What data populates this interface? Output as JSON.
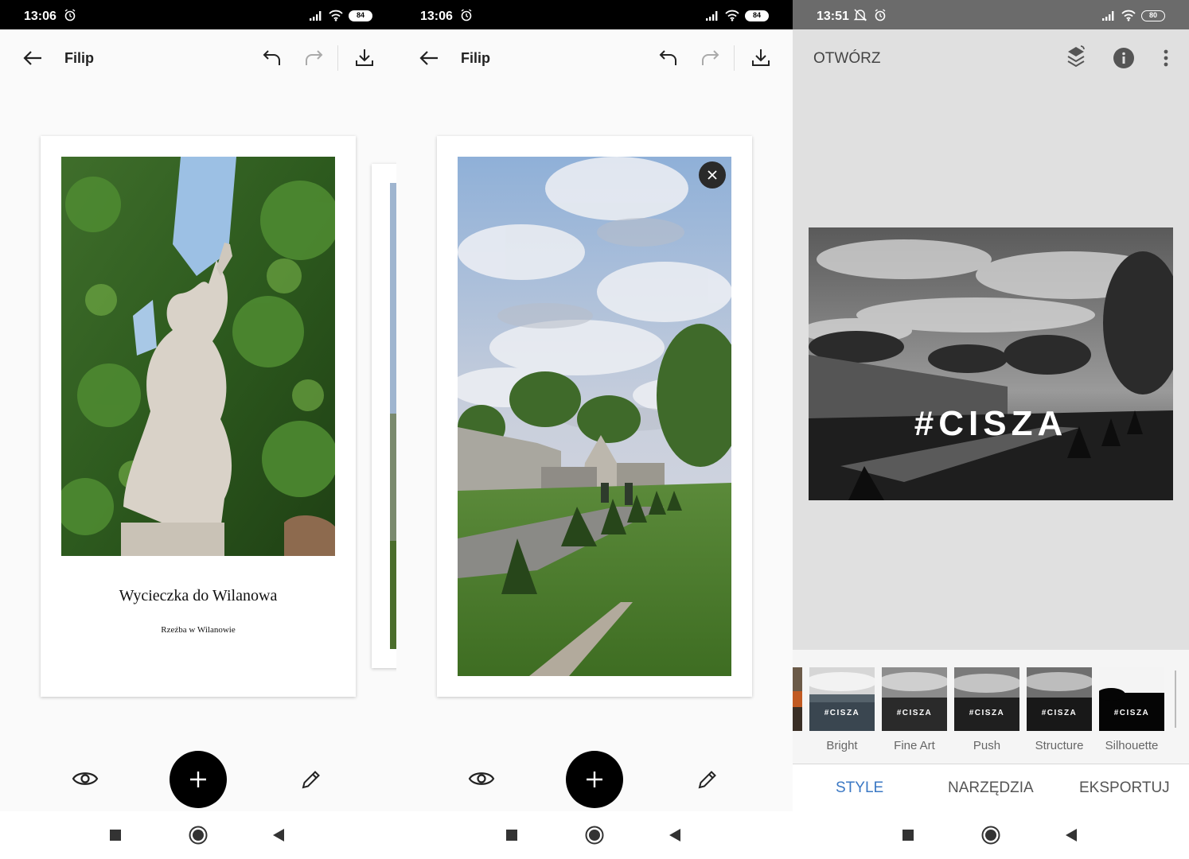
{
  "panel1": {
    "status": {
      "time": "13:06",
      "battery": "84"
    },
    "appbar": {
      "title": "Filip"
    },
    "card": {
      "title": "Wycieczka do Wilanowa",
      "caption": "Rzeźba w Wilanowie"
    }
  },
  "panel2": {
    "status": {
      "time": "13:06",
      "battery": "84"
    },
    "appbar": {
      "title": "Filip"
    }
  },
  "panel3": {
    "status": {
      "time": "13:51",
      "battery": "80"
    },
    "appbar": {
      "open_label": "OTWÓRZ"
    },
    "image_overlay": "#CISZA",
    "thumbnails": [
      {
        "label": "Bright",
        "tag": "#CISZA"
      },
      {
        "label": "Fine Art",
        "tag": "#CISZA"
      },
      {
        "label": "Push",
        "tag": "#CISZA"
      },
      {
        "label": "Structure",
        "tag": "#CISZA"
      },
      {
        "label": "Silhouette",
        "tag": "#CISZA"
      }
    ],
    "tabs": {
      "style": "STYLE",
      "tools": "NARZĘDZIA",
      "export": "EKSPORTUJ"
    }
  },
  "colors": {
    "accent_blue": "#3b78c4",
    "fab_black": "#000000"
  }
}
